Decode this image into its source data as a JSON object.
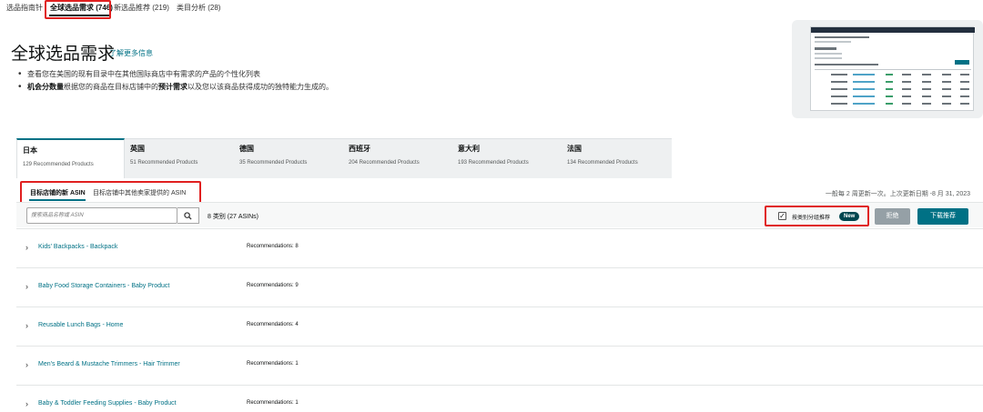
{
  "top_tabs": [
    {
      "label": "选品指南针"
    },
    {
      "label": "全球选品需求 (746)"
    },
    {
      "label": "新选品推荐 (219)"
    },
    {
      "label": "类目分析 (28)"
    }
  ],
  "header": {
    "title": "全球选品需求",
    "learn_more": "了解更多信息",
    "bullet1": "查看您在美国的现有目录中在其他国际商店中有需求的产品的个性化列表",
    "bullet2_bold": "机会分数量",
    "bullet2_mid": "根据您的商品在目标店铺中的",
    "bullet2_bold2": "预计需求",
    "bullet2_end": "以及您以该商品获得成功的独特能力生成的。"
  },
  "country_tabs": [
    {
      "name": "日本",
      "count": "129 Recommended Products"
    },
    {
      "name": "英国",
      "count": "51 Recommended Products"
    },
    {
      "name": "德国",
      "count": "35 Recommended Products"
    },
    {
      "name": "西班牙",
      "count": "204 Recommended Products"
    },
    {
      "name": "意大利",
      "count": "193 Recommended Products"
    },
    {
      "name": "法国",
      "count": "134 Recommended Products"
    }
  ],
  "sub_tabs": [
    {
      "label": "目标店铺的新 ASIN"
    },
    {
      "label": "目标店铺中其他卖家提供的 ASIN"
    }
  ],
  "update_info": "一般每 2 周更新一次。上次更新日期 -8 月 31, 2023",
  "search": {
    "placeholder": "搜索商品名称或 ASIN"
  },
  "category_count": "8 类别 (27 ASINs)",
  "group_checkbox_label": "按类别分组推荐",
  "new_badge": "New",
  "reject_button": "拒绝",
  "download_button": "下载推荐",
  "categories": [
    {
      "name": "Kids' Backpacks - Backpack",
      "recs": "Recommendations: 8"
    },
    {
      "name": "Baby Food Storage Containers - Baby Product",
      "recs": "Recommendations: 9"
    },
    {
      "name": "Reusable Lunch Bags - Home",
      "recs": "Recommendations: 4"
    },
    {
      "name": "Men's Beard & Mustache Trimmers - Hair Trimmer",
      "recs": "Recommendations: 1"
    },
    {
      "name": "Baby & Toddler Feeding Supplies - Baby Product",
      "recs": "Recommendations: 1"
    }
  ],
  "colors": {
    "accent": "#007185",
    "highlight": "#e02020",
    "badge": "#00464f"
  },
  "icons": {
    "search": "search-icon",
    "expand": "chevron-right-icon",
    "check": "check-icon"
  }
}
